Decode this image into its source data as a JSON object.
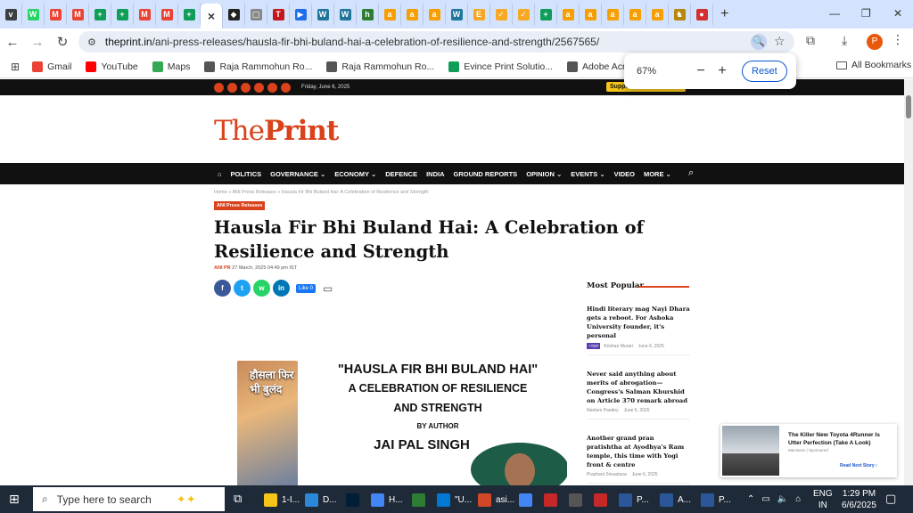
{
  "browser": {
    "tabs": [
      {
        "icon": "v",
        "color": "#3c4043"
      },
      {
        "icon": "W",
        "color": "#25d366"
      },
      {
        "icon": "M",
        "color": "#ea4335"
      },
      {
        "icon": "M",
        "color": "#ea4335"
      },
      {
        "icon": "+",
        "color": "#0f9d58"
      },
      {
        "icon": "+",
        "color": "#0f9d58"
      },
      {
        "icon": "M",
        "color": "#ea4335"
      },
      {
        "icon": "M",
        "color": "#ea4335"
      },
      {
        "icon": "+",
        "color": "#0f9d58"
      },
      {
        "icon": "×",
        "color": "#333",
        "active": true
      },
      {
        "icon": "◆",
        "color": "#222"
      },
      {
        "icon": "▢",
        "color": "#888"
      },
      {
        "icon": "T",
        "color": "#c4161c"
      },
      {
        "icon": "▶",
        "color": "#1f6feb"
      },
      {
        "icon": "W",
        "color": "#21759b"
      },
      {
        "icon": "W",
        "color": "#21759b"
      },
      {
        "icon": "h",
        "color": "#2e7d32"
      },
      {
        "icon": "a",
        "color": "#f59f00"
      },
      {
        "icon": "a",
        "color": "#f59f00"
      },
      {
        "icon": "a",
        "color": "#f59f00"
      },
      {
        "icon": "W",
        "color": "#21759b"
      },
      {
        "icon": "E",
        "color": "#f5a623"
      },
      {
        "icon": "✓",
        "color": "#f9a825"
      },
      {
        "icon": "✓",
        "color": "#f9a825"
      },
      {
        "icon": "+",
        "color": "#0f9d58"
      },
      {
        "icon": "a",
        "color": "#f59f00"
      },
      {
        "icon": "a",
        "color": "#f59f00"
      },
      {
        "icon": "a",
        "color": "#f59f00"
      },
      {
        "icon": "a",
        "color": "#f59f00"
      },
      {
        "icon": "a",
        "color": "#f59f00"
      },
      {
        "icon": "♞",
        "color": "#b8860b"
      },
      {
        "icon": "●",
        "color": "#d32f2f"
      }
    ],
    "new_tab": "+",
    "url_host": "theprint.in",
    "url_path": "/ani-press-releases/hausla-fir-bhi-buland-hai-a-celebration-of-resilience-and-strength/2567565/",
    "profile_initial": "P",
    "bookmarks": [
      {
        "label": "Gmail",
        "icon_color": "#ea4335"
      },
      {
        "label": "YouTube",
        "icon_color": "#ff0000"
      },
      {
        "label": "Maps",
        "icon_color": "#34a853"
      },
      {
        "label": "Raja Rammohun Ro...",
        "icon_color": "#555"
      },
      {
        "label": "Raja Rammohun Ro...",
        "icon_color": "#555"
      },
      {
        "label": "Evince Print Solutio...",
        "icon_color": "#0f9d58"
      },
      {
        "label": "Adobe Acrobat",
        "icon_color": "#555"
      }
    ],
    "all_bookmarks": "All Bookmarks",
    "zoom": {
      "level": "67%",
      "minus": "−",
      "plus": "+",
      "reset": "Reset"
    }
  },
  "site": {
    "date": "Friday, June 6, 2025",
    "support": "Support Our Journalism",
    "logo_the": "The",
    "logo_print": "Print",
    "nav": [
      "⌂",
      "POLITICS",
      "GOVERNANCE ⌄",
      "ECONOMY ⌄",
      "DEFENCE",
      "INDIA",
      "GROUND REPORTS",
      "OPINION ⌄",
      "EVENTS ⌄",
      "VIDEO",
      "MORE ⌄"
    ],
    "breadcrumb": "Home » ANI Press Releases » Hausla Fir Bhi Buland Hai: A Celebration of Resilience and Strength",
    "tag": "ANI Press Releases",
    "headline": "Hausla Fir Bhi Buland Hai: A Celebration of Resilience and Strength",
    "author": "ANI PR",
    "published": "27 March, 2025 04:49 pm IST",
    "like_label": "Like 0",
    "image": {
      "book_title": "हौसला फिर भी बुलंद",
      "line1": "\"HAUSLA FIR BHI BULAND HAI\"",
      "line2": "A CELEBRATION OF RESILIENCE",
      "line3": "AND STRENGTH",
      "line4": "BY AUTHOR",
      "line5": "JAI PAL SINGH"
    },
    "sidebar": {
      "title": "Most Popular",
      "items": [
        {
          "title": "Hindi literary mag Nayi Dhara gets a reboot. For Ashoka University founder, it's personal",
          "badge": "+TEP",
          "author": "Krishan Murari",
          "date": "June 6, 2025"
        },
        {
          "title": "Never said anything about merits of abrogation—Congress's Salman Khurshid on Article 370 remark abroad",
          "author": "Neelam Pandey",
          "date": "June 6, 2025"
        },
        {
          "title": "Another grand pran pratishtha at Ayodhya's Ram temple, this time with Yogi front & centre",
          "author": "Prashant Srivastava",
          "date": "June 6, 2025"
        }
      ]
    },
    "ad": {
      "title": "The Killer New Toyota 4Runner Is Utter Perfection (Take A Look)",
      "sponsor": "Mansions | Sponsored",
      "cta": "Read Next Story ›"
    }
  },
  "taskbar": {
    "search_placeholder": "Type here to search",
    "apps": [
      {
        "label": "1-I...",
        "color": "#f5c518"
      },
      {
        "label": "D...",
        "color": "#2b88d8"
      },
      {
        "label": "",
        "color": "#001e36"
      },
      {
        "label": "H...",
        "color": "#4285f4"
      },
      {
        "label": "",
        "color": "#2e7d32"
      },
      {
        "label": "\"U...",
        "color": "#0078d4"
      },
      {
        "label": "asi...",
        "color": "#d24726"
      },
      {
        "label": "",
        "color": "#4285f4"
      },
      {
        "label": "",
        "color": "#c62828"
      },
      {
        "label": "",
        "color": "#555"
      },
      {
        "label": "",
        "color": "#c62828"
      },
      {
        "label": "P...",
        "color": "#2b579a"
      },
      {
        "label": "A...",
        "color": "#2b579a"
      },
      {
        "label": "P...",
        "color": "#2b579a"
      }
    ],
    "lang1": "ENG",
    "lang2": "IN",
    "time": "1:29 PM",
    "date": "6/6/2025"
  }
}
